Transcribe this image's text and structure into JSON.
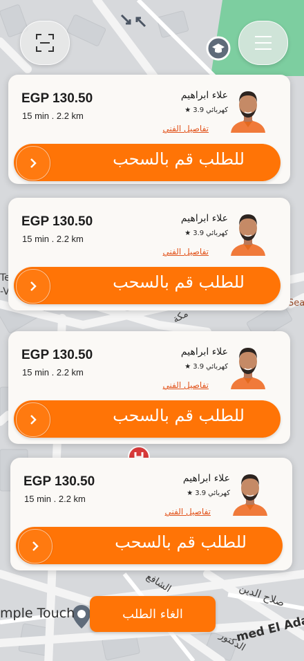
{
  "map": {
    "labels": {
      "place_left": "mple Touch",
      "street_bottom": "med El Ada",
      "street_ar_1": "صلاح الدين",
      "street_ar_2": "الدكتور",
      "street_ar_3": "الشافع",
      "street_ar_4": "مكة",
      "edge_right_1": "Sea",
      "edge_left_1": "Te",
      "edge_left_2": "-V"
    }
  },
  "top_bar": {
    "scan_icon": "scan-frame-icon",
    "menu_icon": "hamburger-menu-icon"
  },
  "cards": [
    {
      "price": "EGP 130.50",
      "eta": "15 min . 2.2 km",
      "driver_name": "علاء ابراهيم",
      "car_type": "كهربائي",
      "rating": "3.9",
      "details_link": "تفاصيل الفني",
      "swipe_label": "للطلب قم بالسحب"
    },
    {
      "price": "EGP 130.50",
      "eta": "15 min . 2.2 km",
      "driver_name": "علاء ابراهيم",
      "car_type": "كهربائي",
      "rating": "3.9",
      "details_link": "تفاصيل الفني",
      "swipe_label": "للطلب قم بالسحب"
    },
    {
      "price": "EGP 130.50",
      "eta": "15 min . 2.2 km",
      "driver_name": "علاء ابراهيم",
      "car_type": "كهربائي",
      "rating": "3.9",
      "details_link": "تفاصيل الفني",
      "swipe_label": "للطلب قم بالسحب"
    },
    {
      "price": "EGP 130.50",
      "eta": "15 min . 2.2 km",
      "driver_name": "علاء ابراهيم",
      "car_type": "كهربائي",
      "rating": "3.9",
      "details_link": "تفاصيل الفني",
      "swipe_label": "للطلب قم بالسحب"
    }
  ],
  "cancel_button": {
    "label": "الغاء الطلب"
  },
  "colors": {
    "accent": "#ff7406",
    "link": "#e2531b",
    "card_bg": "#fbf9f6"
  }
}
